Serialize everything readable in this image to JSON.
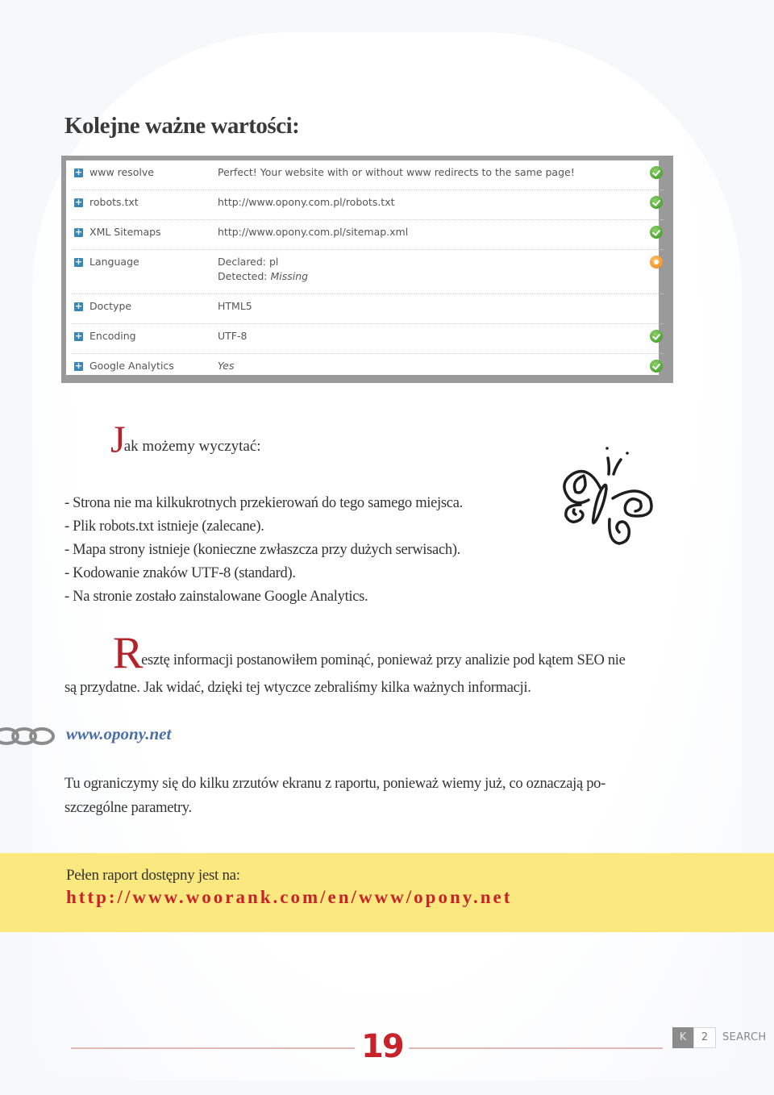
{
  "section_title": "Kolejne ważne wartości:",
  "report": {
    "rows": [
      {
        "label": "www resolve",
        "value": "Perfect! Your website with or without www redirects to the same page!",
        "status": "ok"
      },
      {
        "label": "robots.txt",
        "value": "http://www.opony.com.pl/robots.txt",
        "status": "ok"
      },
      {
        "label": "XML Sitemaps",
        "value": "http://www.opony.com.pl/sitemap.xml",
        "status": "ok"
      },
      {
        "label": "Language",
        "value_line1": "Declared: pl",
        "value_line2_prefix": "Detected: ",
        "value_line2_em": "Missing",
        "status": "warn"
      },
      {
        "label": "Doctype",
        "value": "HTML5",
        "status": "none"
      },
      {
        "label": "Encoding",
        "value": "UTF-8",
        "status": "ok"
      },
      {
        "label": "Google Analytics",
        "value": "Yes",
        "status": "ok"
      }
    ],
    "colors": {
      "ok": "#4da532",
      "warn": "#f2962a",
      "expand": "#3a86b4"
    }
  },
  "conclusion": {
    "dropcap": "J",
    "heading_rest": "ak możemy wyczytać:",
    "bullets": [
      "- Strona nie ma kilkukrotnych przekierowań do tego samego miejsca.",
      "- Plik robots.txt istnieje (zalecane).",
      "- Mapa strony istnieje (konieczne zwłaszcza przy dużych serwisach).",
      "- Kodowanie znaków UTF-8 (standard).",
      "- Na stronie zostało zainstalowane Google Analytics."
    ]
  },
  "paragraph1": {
    "dropcap": "R",
    "line1": "esztę informacji postanowiłem pominąć, ponieważ przy analizie pod kątem SEO nie",
    "line2": "są przydatne. Jak widać, dzięki tej wtyczce zebraliśmy kilka ważnych informacji."
  },
  "site_link": "www.opony.net",
  "paragraph2": {
    "line1": "Tu ograniczymy się do kilku zrzutów ekranu z raportu, ponieważ wiemy już, co oznaczają po-",
    "line2": "szczególne parametry."
  },
  "banner": {
    "label": "Pełen raport dostępny jest na:",
    "url": "http://www.woorank.com/en/www/opony.net",
    "background": "#fbe97f",
    "url_color": "#c8232b"
  },
  "footer": {
    "page_number": "19",
    "pager": {
      "k": "K",
      "page": "2",
      "search": "SEARCH"
    }
  },
  "accent_color": "#b3232b"
}
